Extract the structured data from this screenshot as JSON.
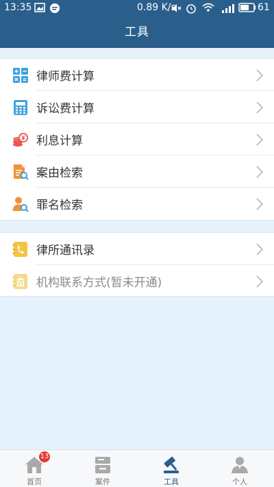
{
  "status_bar": {
    "time": "13:35",
    "net_speed": "0.89 K/s",
    "battery": "61"
  },
  "header": {
    "title": "工具"
  },
  "groups": [
    {
      "items": [
        {
          "label": "律师费计算",
          "icon": "calculator-grid-icon",
          "enabled": true
        },
        {
          "label": "诉讼费计算",
          "icon": "calculator-icon",
          "enabled": true
        },
        {
          "label": "利息计算",
          "icon": "coins-icon",
          "enabled": true
        },
        {
          "label": "案由检索",
          "icon": "document-search-icon",
          "enabled": true
        },
        {
          "label": "罪名检索",
          "icon": "person-search-icon",
          "enabled": true
        }
      ]
    },
    {
      "items": [
        {
          "label": "律所通讯录",
          "icon": "phone-book-icon",
          "enabled": true
        },
        {
          "label": "机构联系方式(暂未开通)",
          "icon": "institution-icon",
          "enabled": false
        }
      ]
    }
  ],
  "tabs": [
    {
      "label": "首页",
      "icon": "home-icon",
      "badge": "13",
      "active": false
    },
    {
      "label": "案件",
      "icon": "case-icon",
      "active": false
    },
    {
      "label": "工具",
      "icon": "gavel-icon",
      "active": true
    },
    {
      "label": "个人",
      "icon": "person-icon",
      "active": false
    }
  ],
  "colors": {
    "primary": "#2a5f8c",
    "background": "#e5f1fb",
    "badge": "#e53935"
  }
}
